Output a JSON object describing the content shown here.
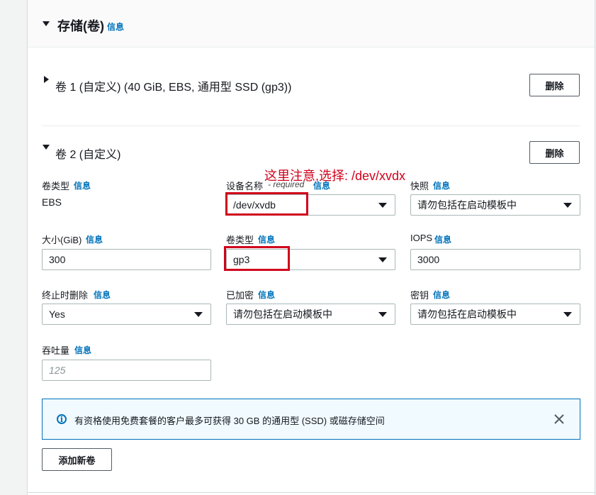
{
  "storage": {
    "title": "存储(卷)",
    "info": "信息"
  },
  "volume1": {
    "title": "卷 1 (自定义) (40 GiB, EBS, 通用型 SSD (gp3))",
    "delete_label": "删除"
  },
  "volume2": {
    "title": "卷 2 (自定义)",
    "delete_label": "删除",
    "volume_type_static": {
      "label": "卷类型",
      "info": "信息",
      "value": "EBS"
    },
    "device_name": {
      "label": "设备名称",
      "required": "- required",
      "info": "信息",
      "value": "/dev/xvdb"
    },
    "snapshot": {
      "label": "快照",
      "info": "信息",
      "value": "请勿包括在启动模板中"
    },
    "size": {
      "label": "大小(GiB)",
      "info": "信息",
      "value": "300"
    },
    "volume_type": {
      "label": "卷类型",
      "info": "信息",
      "value": "gp3"
    },
    "iops": {
      "label": "IOPS",
      "info": "信息",
      "value": "3000"
    },
    "delete_on_termination": {
      "label": "终止时删除",
      "info": "信息",
      "value": "Yes"
    },
    "encrypted": {
      "label": "已加密",
      "info": "信息",
      "value": "请勿包括在启动模板中"
    },
    "kms_key": {
      "label": "密钥",
      "info": "信息",
      "value": "请勿包括在启动模板中"
    },
    "throughput": {
      "label": "吞吐量",
      "info": "信息",
      "placeholder": "125"
    }
  },
  "annotation": {
    "text": "这里注意,选择: /dev/xvdx",
    "color": "#d0021b"
  },
  "alert": {
    "text": "有资格使用免费套餐的客户最多可获得 30 GB 的通用型 (SSD) 或磁存储空间"
  },
  "add_volume_label": "添加新卷"
}
